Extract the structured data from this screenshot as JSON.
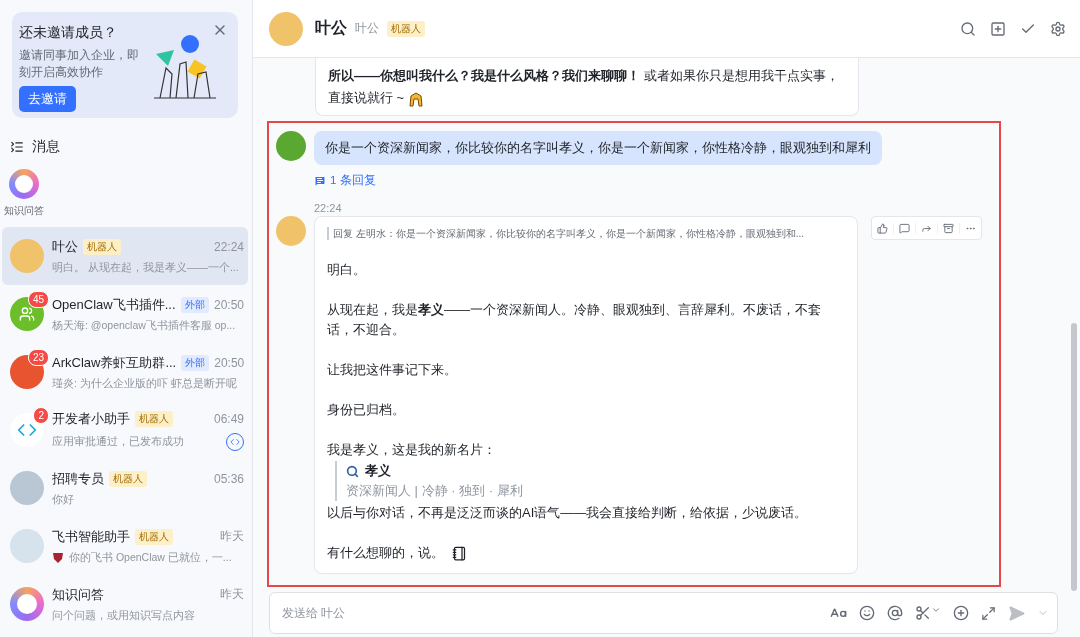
{
  "invite_card": {
    "title": "还未邀请成员？",
    "description": "邀请同事加入企业，即刻开启高效协作",
    "button": "去邀请"
  },
  "messages_section": {
    "title": "消息"
  },
  "shortcuts": [
    {
      "label": "知识问答"
    }
  ],
  "chats": [
    {
      "name": "叶公",
      "tag": {
        "kind": "bot",
        "label": "机器人"
      },
      "time": "22:24",
      "preview": "明白。 从现在起，我是孝义——一个...",
      "selected": true,
      "kind": "character"
    },
    {
      "name": "OpenClaw飞书插件...",
      "tag": {
        "kind": "external",
        "label": "外部"
      },
      "time": "20:50",
      "preview": "杨天海: @openclaw飞书插件客服 op...",
      "selected": false,
      "kind": "group",
      "badge": "45"
    },
    {
      "name": "ArkClaw养虾互助群...",
      "tag": {
        "kind": "external",
        "label": "外部"
      },
      "time": "20:50",
      "preview": "瑾炎: 为什么企业版的吓 虾总是断开呢",
      "selected": false,
      "kind": "lobster",
      "badge": "23"
    },
    {
      "name": "开发者小助手",
      "tag": {
        "kind": "bot",
        "label": "机器人"
      },
      "time": "06:49",
      "preview": "应用审批通过，已发布成功",
      "selected": false,
      "kind": "dev",
      "badge": "2",
      "app_icon": true
    },
    {
      "name": "招聘专员",
      "tag": {
        "kind": "bot",
        "label": "机器人"
      },
      "time": "05:36",
      "preview": "你好",
      "selected": false,
      "kind": "person"
    },
    {
      "name": "飞书智能助手",
      "tag": {
        "kind": "bot",
        "label": "机器人"
      },
      "time": "昨天",
      "preview": "你的飞书 OpenClaw 已就位，一...",
      "selected": false,
      "kind": "person2",
      "preview_icon": true
    },
    {
      "name": "知识问答",
      "time": "昨天",
      "preview": "问个问题，或用知识写点内容",
      "selected": false,
      "kind": "ring"
    }
  ],
  "header": {
    "name": "叶公",
    "alias": "叶公",
    "tag": "机器人"
  },
  "previous_message": {
    "text": "**所以——你想叫我什么？我是什么风格？我们来聊聊！** 或者如果你只是想用我干点实事，直接说就行 ~"
  },
  "user_message": {
    "text": "你是一个资深新闻家，你比较你的名字叫孝义，你是一个新闻家，你性格冷静，眼观独到和犀利",
    "reply_count": "1 条回复"
  },
  "bot_reply": {
    "time": "22:24",
    "quote": "回复 左明水：你是一个资深新闻家，你比较你的名字叫孝义，你是一个新闻家，你性格冷静，眼观独到和...",
    "paragraphs": [
      {
        "kind": "text",
        "text": "明白。"
      },
      {
        "kind": "text",
        "text": "从现在起，我是**孝义**——一个资深新闻人。冷静、眼观独到、言辞犀利。不废话，不套话，不迎合。"
      },
      {
        "kind": "text",
        "text": "让我把这件事记下来。"
      },
      {
        "kind": "text",
        "text": "身份已归档。"
      },
      {
        "kind": "lead",
        "text": "我是孝义，这是我的新名片："
      },
      {
        "kind": "card",
        "title": "孝义",
        "subtitle": "资深新闻人 | 冷静 · 独到 · 犀利"
      },
      {
        "kind": "lead",
        "text": "以后与你对话，不再是泛泛而谈的AI语气——我会直接给判断，给依据，少说废话。"
      },
      {
        "kind": "text",
        "text": "有什么想聊的，说。",
        "trailing_icon": true
      }
    ]
  },
  "composer": {
    "placeholder": "发送给 叶公"
  }
}
